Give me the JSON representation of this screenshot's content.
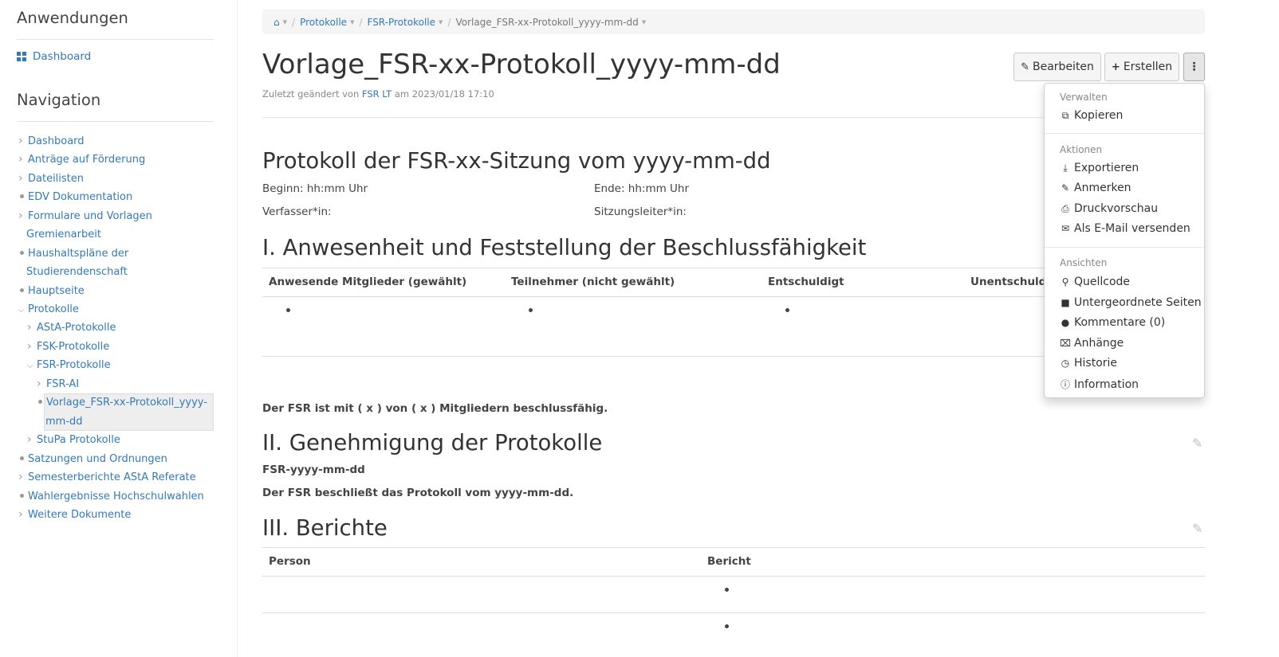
{
  "sidebar": {
    "applications_heading": "Anwendungen",
    "dashboard_link": "Dashboard",
    "navigation_heading": "Navigation",
    "nav": [
      {
        "label": "Dashboard",
        "marker": "chevron"
      },
      {
        "label": "Anträge auf Förderung",
        "marker": "chevron"
      },
      {
        "label": "Dateilisten",
        "marker": "chevron"
      },
      {
        "label": "EDV Dokumentation",
        "marker": "dot"
      },
      {
        "label": "Formulare und Vorlagen",
        "marker": "chevron"
      },
      {
        "label": "Gremienarbeit",
        "marker": "none"
      },
      {
        "label": "Haushaltspläne der",
        "marker": "dot"
      },
      {
        "label": "Studierendenschaft",
        "marker": "none"
      },
      {
        "label": "Hauptseite",
        "marker": "dot"
      },
      {
        "label": "Protokolle",
        "marker": "open"
      },
      {
        "label": "AStA-Protokolle",
        "marker": "chevron"
      },
      {
        "label": "FSK-Protokolle",
        "marker": "chevron"
      },
      {
        "label": "FSR-Protokolle",
        "marker": "open"
      },
      {
        "label": "FSR-AI",
        "marker": "chevron"
      },
      {
        "label": "Vorlage_FSR-xx-Protokoll_yyyy-",
        "marker": "dot"
      },
      {
        "label": "mm-dd",
        "marker": "none"
      },
      {
        "label": "StuPa Protokolle",
        "marker": "chevron"
      },
      {
        "label": "Satzungen und Ordnungen",
        "marker": "dot"
      },
      {
        "label": "Semesterberichte AStA Referate",
        "marker": "chevron"
      },
      {
        "label": "Wahlergebnisse Hochschulwahlen",
        "marker": "dot"
      },
      {
        "label": "Weitere Dokumente",
        "marker": "chevron"
      }
    ]
  },
  "breadcrumb": {
    "home_icon": "home-icon",
    "items": [
      "Protokolle",
      "FSR-Protokolle",
      "Vorlage_FSR-xx-Protokoll_yyyy-mm-dd"
    ]
  },
  "page": {
    "title": "Vorlage_FSR-xx-Protokoll_yyyy-mm-dd",
    "modified_prefix": "Zuletzt geändert von",
    "modified_user": "FSR LT",
    "modified_suffix": "am 2023/01/18 17:10"
  },
  "toolbar": {
    "edit_label": "Bearbeiten",
    "create_label": "Erstellen",
    "more_icon": "vertical-ellipsis-icon"
  },
  "content": {
    "heading": "Protokoll der FSR-xx-Sitzung vom yyyy-mm-dd",
    "beginn": "Beginn: hh:mm Uhr",
    "ende": "Ende: hh:mm Uhr",
    "verfasser": "Verfasser*in:",
    "sitzungsleiter": "Sitzungsleiter*in:",
    "section1": "I. Anwesenheit und Feststellung der Beschlussfähigkeit",
    "attendance_headers": [
      "Anwesende Mitglieder (gewählt)",
      "Teilnehmer (nicht gewählt)",
      "Entschuldigt",
      "Unentschuldigt"
    ],
    "quorum": "Der FSR ist mit ( x ) von ( x ) Mitgliedern beschlussfähig.",
    "section2": "II. Genehmigung der Protokolle",
    "protocol_name": "FSR-yyyy-mm-dd",
    "protocol_decision": "Der FSR beschließt das Protokoll vom yyyy-mm-dd.",
    "section3": "III. Berichte",
    "report_headers": [
      "Person",
      "Bericht"
    ]
  },
  "dropdown": {
    "manage_heading": "Verwalten",
    "copy": "Kopieren",
    "actions_heading": "Aktionen",
    "export": "Exportieren",
    "annotate": "Anmerken",
    "print_preview": "Druckvorschau",
    "email": "Als E-Mail versenden",
    "views_heading": "Ansichten",
    "source": "Quellcode",
    "children": "Untergeordnete Seiten",
    "comments": "Kommentare (0)",
    "attachments": "Anhänge",
    "history": "Historie",
    "information": "Information"
  },
  "colors": {
    "link": "#337ab7",
    "active_nav_bg": "#eeeeee",
    "breadcrumb_bg": "#f5f5f5"
  }
}
